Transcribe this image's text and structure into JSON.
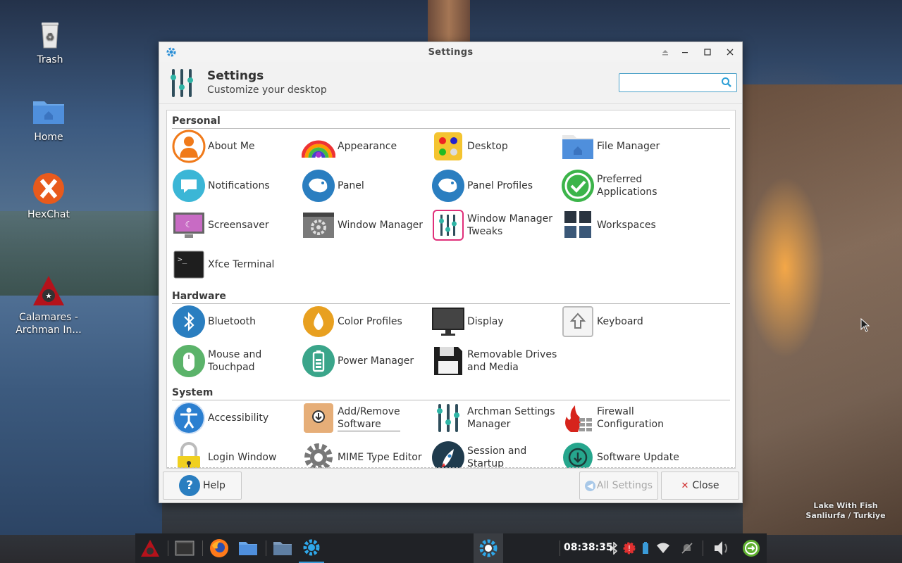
{
  "desktop": {
    "icons": [
      {
        "label": "Trash",
        "icon": "trash-icon"
      },
      {
        "label": "Home",
        "icon": "home-folder-icon"
      },
      {
        "label": "HexChat",
        "icon": "hexchat-icon"
      },
      {
        "label": "Calamares -\nArchman In...",
        "icon": "calamares-installer-icon"
      }
    ],
    "wallpaper_caption_line1": "Lake With Fish",
    "wallpaper_caption_line2": "Sanliurfa / Turkiye"
  },
  "window": {
    "title": "Settings",
    "header_title": "Settings",
    "header_subtitle": "Customize your desktop",
    "search_placeholder": "",
    "controls": [
      "shade",
      "minimize",
      "maximize",
      "close"
    ]
  },
  "sections": [
    {
      "title": "Personal",
      "items": [
        {
          "label": "About Me",
          "icon": "about-me-icon"
        },
        {
          "label": "Appearance",
          "icon": "appearance-icon"
        },
        {
          "label": "Desktop",
          "icon": "desktop-icon"
        },
        {
          "label": "File Manager",
          "icon": "file-manager-icon"
        },
        {
          "label": "Notifications",
          "icon": "notifications-icon"
        },
        {
          "label": "Panel",
          "icon": "panel-icon"
        },
        {
          "label": "Panel Profiles",
          "icon": "panel-profiles-icon"
        },
        {
          "label": "Preferred\nApplications",
          "icon": "preferred-applications-icon"
        },
        {
          "label": "Screensaver",
          "icon": "screensaver-icon"
        },
        {
          "label": "Window Manager",
          "icon": "window-manager-icon"
        },
        {
          "label": "Window Manager\nTweaks",
          "icon": "window-manager-tweaks-icon"
        },
        {
          "label": "Workspaces",
          "icon": "workspaces-icon"
        },
        {
          "label": "Xfce Terminal",
          "icon": "terminal-icon"
        }
      ]
    },
    {
      "title": "Hardware",
      "items": [
        {
          "label": "Bluetooth",
          "icon": "bluetooth-icon"
        },
        {
          "label": "Color Profiles",
          "icon": "color-profiles-icon"
        },
        {
          "label": "Display",
          "icon": "display-icon"
        },
        {
          "label": "Keyboard",
          "icon": "keyboard-icon"
        },
        {
          "label": "Mouse and\nTouchpad",
          "icon": "mouse-icon"
        },
        {
          "label": "Power Manager",
          "icon": "power-manager-icon"
        },
        {
          "label": "Removable Drives\nand Media",
          "icon": "removable-drives-icon"
        }
      ]
    },
    {
      "title": "System",
      "items": [
        {
          "label": "Accessibility",
          "icon": "accessibility-icon"
        },
        {
          "label": "Add/Remove\nSoftware",
          "icon": "add-remove-software-icon"
        },
        {
          "label": "Archman Settings\nManager",
          "icon": "archman-settings-icon"
        },
        {
          "label": "Firewall\nConfiguration",
          "icon": "firewall-icon"
        },
        {
          "label": "Login Window",
          "icon": "login-window-icon"
        },
        {
          "label": "MIME Type Editor",
          "icon": "mime-type-editor-icon"
        },
        {
          "label": "Session and\nStartup",
          "icon": "session-startup-icon"
        },
        {
          "label": "Software Update",
          "icon": "software-update-icon"
        }
      ]
    }
  ],
  "footer": {
    "help_label": "Help",
    "all_settings_label": "All Settings",
    "close_label": "Close"
  },
  "taskbar": {
    "clock": "08:38:35",
    "launchers": [
      "archman-menu-icon",
      "terminal-icon",
      "firefox-icon",
      "home-folder-icon",
      "folder-icon",
      "settings-icon"
    ],
    "tray": [
      "bluetooth-icon",
      "update-notifier-icon",
      "battery-icon",
      "wifi-icon",
      "notifications-muted-icon",
      "volume-icon",
      "logout-icon"
    ]
  },
  "colors": {
    "accent": "#3a9bd8",
    "teal": "#2fa89a",
    "close_red": "#d03030"
  }
}
